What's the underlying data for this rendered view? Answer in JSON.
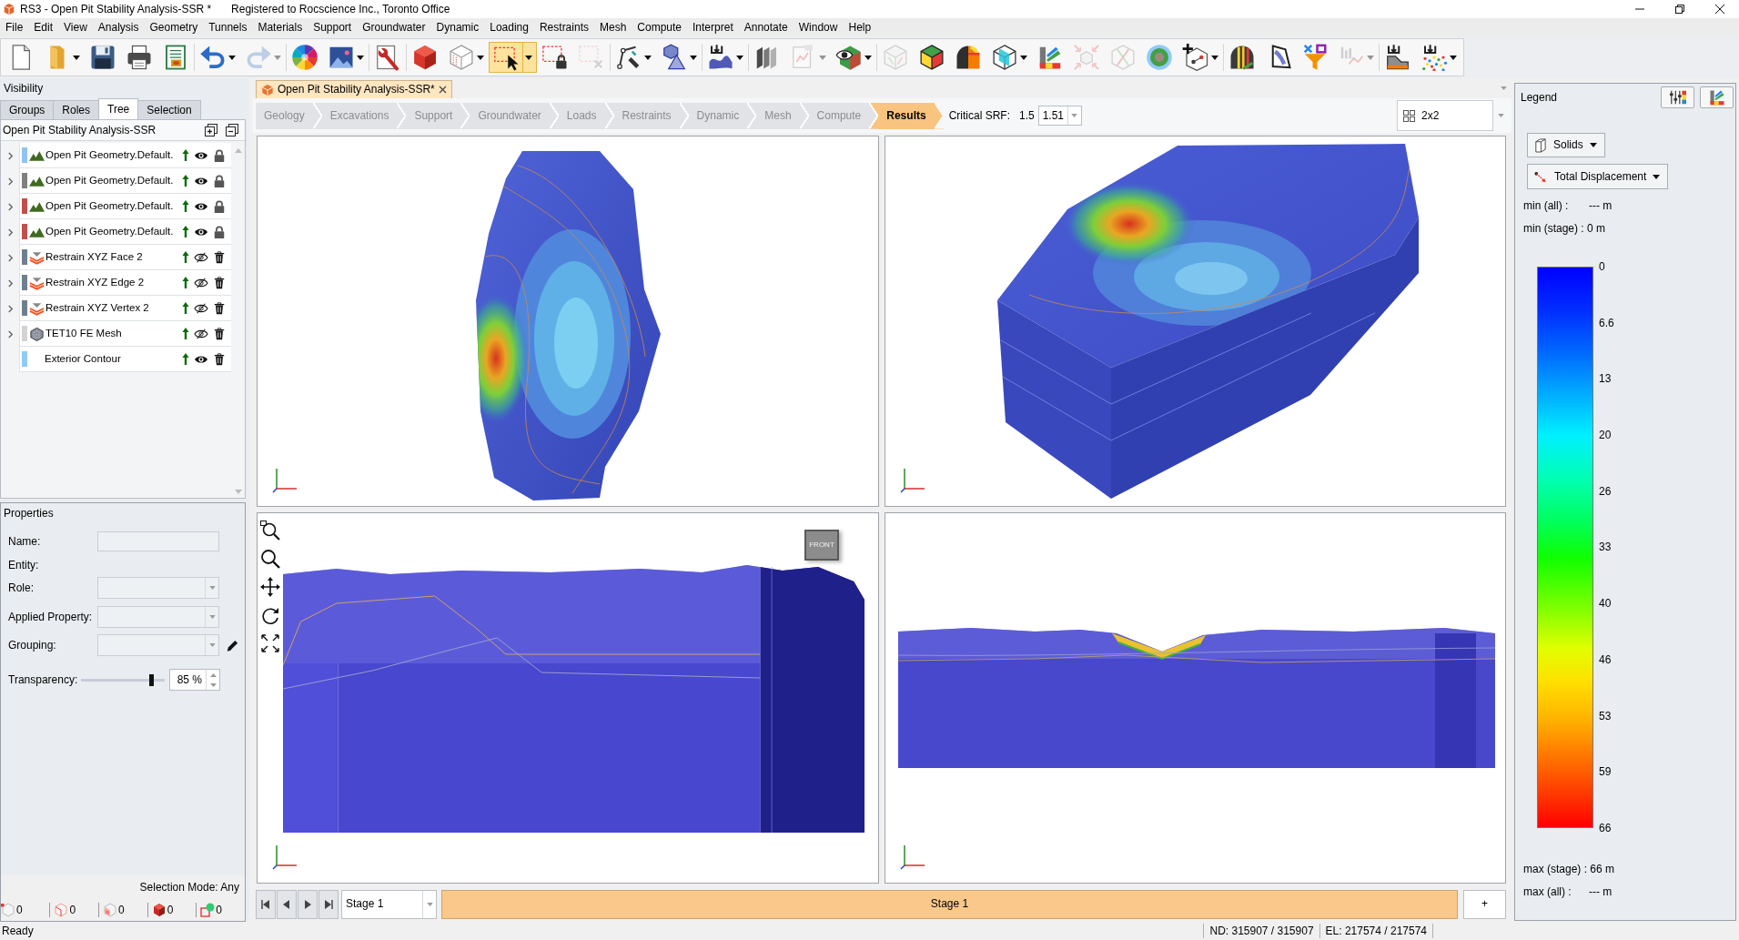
{
  "window": {
    "title": "RS3 - Open Pit Stability Analysis-SSR *",
    "registration": "Registered to Rocscience Inc., Toronto Office"
  },
  "menu": [
    "File",
    "Edit",
    "View",
    "Analysis",
    "Geometry",
    "Tunnels",
    "Materials",
    "Support",
    "Groundwater",
    "Dynamic",
    "Loading",
    "Restraints",
    "Mesh",
    "Compute",
    "Interpret",
    "Annotate",
    "Window",
    "Help"
  ],
  "toolbar": [
    [
      {
        "kind": "new-document",
        "dropdown": false,
        "disabled": false,
        "selected": false
      },
      {
        "kind": "folder",
        "dropdown": true,
        "disabled": false,
        "selected": false
      },
      {
        "kind": "save",
        "dropdown": false,
        "disabled": false,
        "selected": false
      },
      {
        "kind": "printer",
        "dropdown": false,
        "disabled": false,
        "selected": false
      },
      {
        "kind": "report",
        "dropdown": false,
        "disabled": false,
        "selected": false
      }
    ],
    [
      {
        "kind": "undo",
        "dropdown": true,
        "disabled": false,
        "selected": false
      },
      {
        "kind": "redo",
        "dropdown": true,
        "disabled": true,
        "selected": false
      }
    ],
    [
      {
        "kind": "hue-wheel",
        "dropdown": false,
        "disabled": false,
        "selected": false
      },
      {
        "kind": "picture",
        "dropdown": true,
        "disabled": false,
        "selected": false
      }
    ],
    [
      {
        "kind": "wrench-document",
        "dropdown": false,
        "disabled": false,
        "selected": false
      }
    ],
    [
      {
        "kind": "solid-cube",
        "dropdown": false,
        "disabled": false,
        "selected": false
      },
      {
        "kind": "wireframe-cube",
        "dropdown": true,
        "disabled": false,
        "selected": false
      },
      {
        "kind": "selection-rectangle",
        "dropdown": true,
        "disabled": false,
        "selected": true
      },
      {
        "kind": "locked-selection",
        "dropdown": false,
        "disabled": false,
        "selected": false
      },
      {
        "kind": "clear-selection",
        "dropdown": false,
        "disabled": true,
        "selected": false
      }
    ],
    [
      {
        "kind": "polyline",
        "dropdown": true,
        "disabled": false,
        "selected": false
      },
      {
        "kind": "shapes",
        "dropdown": true,
        "disabled": false,
        "selected": false
      }
    ],
    [
      {
        "kind": "import-surface",
        "dropdown": true,
        "disabled": false,
        "selected": false
      }
    ],
    [
      {
        "kind": "layers",
        "dropdown": false,
        "disabled": false,
        "selected": false
      },
      {
        "kind": "chart-document",
        "dropdown": true,
        "disabled": true,
        "selected": false
      },
      {
        "kind": "eye-cube",
        "dropdown": true,
        "disabled": false,
        "selected": false
      }
    ],
    [
      {
        "kind": "cube-outline",
        "dropdown": false,
        "disabled": true,
        "selected": false
      },
      {
        "kind": "shaded-cube",
        "dropdown": false,
        "disabled": false,
        "selected": false
      },
      {
        "kind": "tunnel",
        "dropdown": false,
        "disabled": false,
        "selected": false
      },
      {
        "kind": "cube-plane",
        "dropdown": true,
        "disabled": false,
        "selected": false
      },
      {
        "kind": "contour-legend",
        "dropdown": false,
        "disabled": false,
        "selected": false
      },
      {
        "kind": "cube-arrows",
        "dropdown": false,
        "disabled": true,
        "selected": false
      },
      {
        "kind": "crossed-cube",
        "dropdown": false,
        "disabled": true,
        "selected": false
      },
      {
        "kind": "target",
        "dropdown": false,
        "disabled": false,
        "selected": false
      },
      {
        "kind": "add-point-cube",
        "dropdown": true,
        "disabled": false,
        "selected": false
      }
    ],
    [
      {
        "kind": "striped-tunnel",
        "dropdown": false,
        "disabled": false,
        "selected": false
      },
      {
        "kind": "curved-surface",
        "dropdown": false,
        "disabled": false,
        "selected": false
      },
      {
        "kind": "filter",
        "dropdown": false,
        "disabled": false,
        "selected": false
      },
      {
        "kind": "chart",
        "dropdown": true,
        "disabled": true,
        "selected": false
      }
    ],
    [
      {
        "kind": "import-block",
        "dropdown": false,
        "disabled": false,
        "selected": false
      },
      {
        "kind": "import-points",
        "dropdown": true,
        "disabled": false,
        "selected": false
      }
    ]
  ],
  "visibility": {
    "title": "Visibility",
    "tabs": [
      {
        "label": "Groups",
        "selected": false
      },
      {
        "label": "Roles",
        "selected": false
      },
      {
        "label": "Tree",
        "selected": true
      },
      {
        "label": "Selection",
        "selected": false
      }
    ],
    "tree_title": "Open Pit Stability Analysis-SSR",
    "items": [
      {
        "label": "Open Pit Geometry.Default.",
        "kind": "geometry",
        "color": "#8fc4f2",
        "expandable": true,
        "visible": true,
        "locked": true
      },
      {
        "label": "Open Pit Geometry.Default.",
        "kind": "geometry",
        "color": "#808080",
        "expandable": true,
        "visible": true,
        "locked": true
      },
      {
        "label": "Open Pit Geometry.Default.",
        "kind": "geometry",
        "color": "#c0504d",
        "expandable": true,
        "visible": true,
        "locked": true
      },
      {
        "label": "Open Pit Geometry.Default.",
        "kind": "geometry",
        "color": "#c0504d",
        "expandable": true,
        "visible": true,
        "locked": true
      },
      {
        "label": "Restrain XYZ Face 2",
        "kind": "restraint",
        "color": "#6e7f8f",
        "expandable": true,
        "visible": false,
        "locked": false
      },
      {
        "label": "Restrain XYZ Edge 2",
        "kind": "restraint",
        "color": "#6e7f8f",
        "expandable": true,
        "visible": false,
        "locked": false
      },
      {
        "label": "Restrain XYZ Vertex 2",
        "kind": "restraint",
        "color": "#6e7f8f",
        "expandable": true,
        "visible": false,
        "locked": false
      },
      {
        "label": "TET10 FE Mesh",
        "kind": "mesh",
        "color": "#d3d3d3",
        "expandable": true,
        "visible": false,
        "locked": false
      },
      {
        "label": "Exterior Contour",
        "kind": "contour",
        "color": "#8ecbf5",
        "expandable": false,
        "visible": true,
        "locked": false
      }
    ]
  },
  "properties": {
    "title": "Properties",
    "fields": [
      {
        "kind": "text",
        "label": "Name:"
      },
      {
        "kind": "static",
        "label": "Entity:"
      },
      {
        "kind": "select",
        "label": "Role:"
      },
      {
        "kind": "select",
        "label": "Applied Property:"
      },
      {
        "kind": "select",
        "label": "Grouping:",
        "editable": true
      }
    ],
    "transparency": {
      "label": "Transparency:",
      "level": 0.85,
      "value": "85 %"
    },
    "selection_mode": "Selection Mode: Any",
    "counts": [
      {
        "kind": "vertex",
        "value": "0"
      },
      {
        "kind": "edge",
        "value": "0"
      },
      {
        "kind": "face",
        "value": "0"
      },
      {
        "kind": "solid",
        "value": "0"
      },
      {
        "kind": "group",
        "value": "0"
      }
    ]
  },
  "document_tab": {
    "title": "Open Pit Stability Analysis-SSR*"
  },
  "workflow": {
    "steps": [
      {
        "label": "Geology",
        "selected": false
      },
      {
        "label": "Excavations",
        "selected": false
      },
      {
        "label": "Support",
        "selected": false
      },
      {
        "label": "Groundwater",
        "selected": false
      },
      {
        "label": "Loads",
        "selected": false
      },
      {
        "label": "Restraints",
        "selected": false
      },
      {
        "label": "Dynamic",
        "selected": false
      },
      {
        "label": "Mesh",
        "selected": false
      },
      {
        "label": "Compute",
        "selected": false
      },
      {
        "label": "Results",
        "selected": true
      }
    ],
    "critical_srf": {
      "label": "Critical SRF:",
      "value": "1.5",
      "spin_value": "1.51"
    },
    "layout": {
      "value": "2x2"
    }
  },
  "viewports": [
    {
      "kind": "plan"
    },
    {
      "kind": "isometric"
    },
    {
      "kind": "front",
      "view_cube": "FRONT",
      "navigation_tools": true
    },
    {
      "kind": "side"
    }
  ],
  "stage_bar": {
    "stage": "Stage 1",
    "current_stage": "Stage 1",
    "add_stage": "+"
  },
  "legend": {
    "title": "Legend",
    "entity": "Solids",
    "result": "Total Displacement",
    "min_all": {
      "label": "min (all) :",
      "value": "--- m"
    },
    "min_stage": "min (stage) : 0 m",
    "scale_labels": [
      "0",
      "6.6",
      "13",
      "20",
      "26",
      "33",
      "40",
      "46",
      "53",
      "59",
      "66"
    ],
    "max_stage": "max (stage) : 66 m",
    "max_all": {
      "label": "max (all) :",
      "value": "--- m"
    }
  },
  "status_bar": {
    "message": "Ready",
    "nodes": "ND: 315907 / 315907",
    "elements": "EL: 217574 / 217574"
  }
}
